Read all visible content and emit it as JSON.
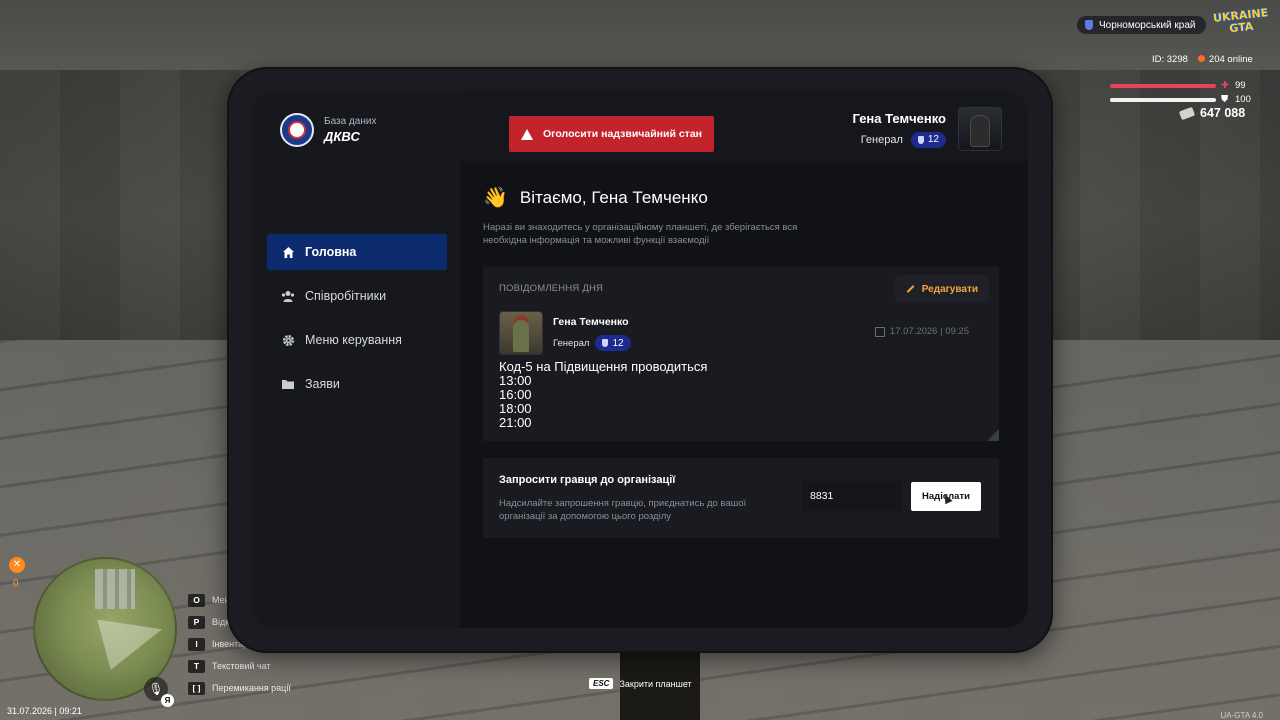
{
  "hud": {
    "region": "Чорноморський край",
    "logo_text": "UKRAINE GTA",
    "player_id": "ID: 3298",
    "online": "204 online",
    "health": "99",
    "armor": "100",
    "money": "647 088",
    "hunger": "0",
    "datetime": "31.07.2026 | 09:21",
    "version": "UA-GTA 4.0",
    "mic_key": "Я",
    "close_hint_key": "ESC",
    "close_hint_label": "Закрити планшет",
    "keys": [
      {
        "key": "O",
        "label": "Меню"
      },
      {
        "key": "P",
        "label": "Відкрити"
      },
      {
        "key": "I",
        "label": "Інвентар"
      },
      {
        "key": "T",
        "label": "Текстовий чат"
      },
      {
        "key": "[ ]",
        "label": "Перемикання рації"
      }
    ]
  },
  "tablet": {
    "brand_sub": "База даних",
    "brand_name": "ДКВС",
    "alert_button": "Оголосити надзвичайний стан",
    "profile": {
      "name": "Гена Темченко",
      "rank": "Генерал",
      "level": "12"
    },
    "nav": [
      {
        "label": "Головна",
        "icon": "home-icon",
        "active": true
      },
      {
        "label": "Співробітники",
        "icon": "users-icon",
        "active": false
      },
      {
        "label": "Меню керування",
        "icon": "gear-icon",
        "active": false
      },
      {
        "label": "Заяви",
        "icon": "folder-icon",
        "active": false
      }
    ],
    "welcome_title": "Вітаємо, Гена Темченко",
    "welcome_desc": "Наразі ви знаходитесь у організаційному планшеті, де зберігається вся необхідна інформація та можливі функції взаємодії",
    "motd": {
      "label": "ПОВІДОМЛЕННЯ ДНЯ",
      "edit_label": "Редагувати",
      "author": "Гена Темченко",
      "author_rank": "Генерал",
      "author_level": "12",
      "date": "17.07.2026 | 09:25",
      "lines": [
        "Код-5 на Підвищення проводиться",
        "13:00",
        "16:00",
        "18:00",
        "21:00"
      ]
    },
    "invite": {
      "title": "Запросити гравця до організації",
      "desc": "Надсилайте запрошення гравцю, приєднатись до вашої організації за допомогою цього розділу",
      "input_value": "8831",
      "send_label": "Надіслати"
    }
  }
}
